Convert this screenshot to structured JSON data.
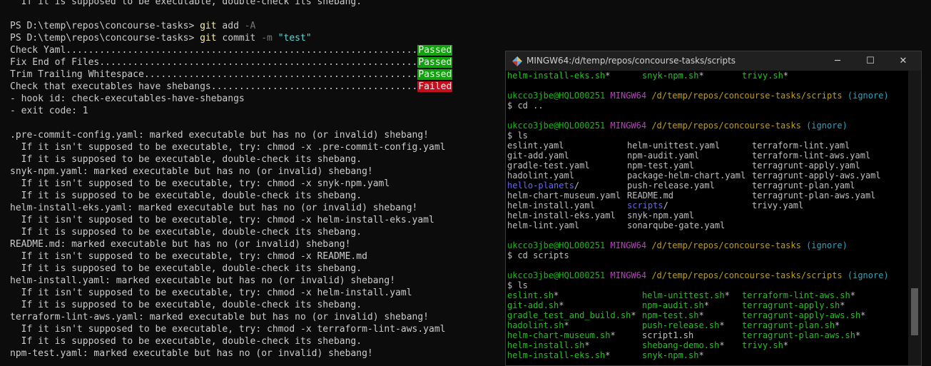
{
  "powershell": {
    "lines": [
      {
        "text": "  If it is supposed to be executable, double-check its shebang."
      },
      {
        "text": ""
      },
      {
        "prompt": "PS D:\\temp\\repos\\concourse-tasks> ",
        "cmd": "git",
        "args": " add ",
        "opt": "-A",
        "str": ""
      },
      {
        "prompt": "PS D:\\temp\\repos\\concourse-tasks> ",
        "cmd": "git",
        "args": " commit ",
        "opt": "-m",
        "str": " \"test\""
      },
      {
        "text": "Check Yaml...............................................................",
        "badge": "Passed",
        "status": "pass"
      },
      {
        "text": "Fix End of Files.........................................................",
        "badge": "Passed",
        "status": "pass"
      },
      {
        "text": "Trim Trailing Whitespace.................................................",
        "badge": "Passed",
        "status": "pass"
      },
      {
        "text": "Check that executables have shebangs.....................................",
        "badge": "Failed",
        "status": "fail"
      },
      {
        "text": "- hook id: check-executables-have-shebangs"
      },
      {
        "text": "- exit code: 1"
      },
      {
        "text": ""
      },
      {
        "text": ".pre-commit-config.yaml: marked executable but has no (or invalid) shebang!"
      },
      {
        "text": "  If it isn't supposed to be executable, try: chmod -x .pre-commit-config.yaml"
      },
      {
        "text": "  If it is supposed to be executable, double-check its shebang."
      },
      {
        "text": "snyk-npm.yaml: marked executable but has no (or invalid) shebang!"
      },
      {
        "text": "  If it isn't supposed to be executable, try: chmod -x snyk-npm.yaml"
      },
      {
        "text": "  If it is supposed to be executable, double-check its shebang."
      },
      {
        "text": "helm-install-eks.yaml: marked executable but has no (or invalid) shebang!"
      },
      {
        "text": "  If it isn't supposed to be executable, try: chmod -x helm-install-eks.yaml"
      },
      {
        "text": "  If it is supposed to be executable, double-check its shebang."
      },
      {
        "text": "README.md: marked executable but has no (or invalid) shebang!"
      },
      {
        "text": "  If it isn't supposed to be executable, try: chmod -x README.md"
      },
      {
        "text": "  If it is supposed to be executable, double-check its shebang."
      },
      {
        "text": "helm-install.yaml: marked executable but has no (or invalid) shebang!"
      },
      {
        "text": "  If it isn't supposed to be executable, try: chmod -x helm-install.yaml"
      },
      {
        "text": "  If it is supposed to be executable, double-check its shebang."
      },
      {
        "text": "terraform-lint-aws.yaml: marked executable but has no (or invalid) shebang!"
      },
      {
        "text": "  If it isn't supposed to be executable, try: chmod -x terraform-lint-aws.yaml"
      },
      {
        "text": "  If it is supposed to be executable, double-check its shebang."
      },
      {
        "text": "npm-test.yaml: marked executable but has no (or invalid) shebang!"
      }
    ]
  },
  "mingw": {
    "title": "MINGW64:/d/temp/repos/concourse-tasks/scripts",
    "buttons": {
      "minimize": "─",
      "maximize": "☐",
      "close": "✕"
    },
    "prompt_user": "ukcco3jbe@HQLO00251",
    "prompt_env": "MINGW64",
    "ignore": "(ignore)",
    "top_row": [
      "helm-install-eks.sh*",
      "snyk-npm.sh*",
      "trivy.sh*"
    ],
    "block1": {
      "path": "/d/temp/repos/concourse-tasks/scripts",
      "cmd": "$ cd .."
    },
    "block2": {
      "path": "/d/temp/repos/concourse-tasks",
      "cmd": "$ ls"
    },
    "ls1": [
      [
        {
          "t": "eslint.yaml",
          "c": ""
        },
        {
          "t": "helm-unittest.yaml",
          "c": ""
        },
        {
          "t": "terraform-lint.yaml",
          "c": ""
        }
      ],
      [
        {
          "t": "git-add.yaml",
          "c": ""
        },
        {
          "t": "npm-audit.yaml",
          "c": ""
        },
        {
          "t": "terraform-lint-aws.yaml",
          "c": ""
        }
      ],
      [
        {
          "t": "gradle-test.yaml",
          "c": ""
        },
        {
          "t": "npm-test.yaml",
          "c": ""
        },
        {
          "t": "terragrunt-apply.yaml",
          "c": ""
        }
      ],
      [
        {
          "t": "hadolint.yaml",
          "c": ""
        },
        {
          "t": "package-helm-chart.yaml",
          "c": ""
        },
        {
          "t": "terragrunt-apply-aws.yaml",
          "c": ""
        }
      ],
      [
        {
          "t": "hello-planets",
          "c": "dir",
          "s": "/"
        },
        {
          "t": "push-release.yaml",
          "c": ""
        },
        {
          "t": "terragrunt-plan.yaml",
          "c": ""
        }
      ],
      [
        {
          "t": "helm-chart-museum.yaml",
          "c": ""
        },
        {
          "t": "README.md",
          "c": ""
        },
        {
          "t": "terragrunt-plan-aws.yaml",
          "c": ""
        }
      ],
      [
        {
          "t": "helm-install.yaml",
          "c": ""
        },
        {
          "t": "scripts",
          "c": "dir",
          "s": "/"
        },
        {
          "t": "trivy.yaml",
          "c": ""
        }
      ],
      [
        {
          "t": "helm-install-eks.yaml",
          "c": ""
        },
        {
          "t": "snyk-npm.yaml",
          "c": ""
        },
        {
          "t": "",
          "c": ""
        }
      ],
      [
        {
          "t": "helm-lint.yaml",
          "c": ""
        },
        {
          "t": "sonarqube-gate.yaml",
          "c": ""
        },
        {
          "t": "",
          "c": ""
        }
      ]
    ],
    "block3": {
      "path": "/d/temp/repos/concourse-tasks",
      "cmd": "$ cd scripts"
    },
    "block4": {
      "path": "/d/temp/repos/concourse-tasks/scripts",
      "cmd": "$ ls"
    },
    "ls2": [
      [
        {
          "t": "eslint.sh",
          "c": "exe",
          "s": "*"
        },
        {
          "t": "helm-unittest.sh",
          "c": "exe",
          "s": "*"
        },
        {
          "t": "terraform-lint-aws.sh",
          "c": "exe",
          "s": "*"
        }
      ],
      [
        {
          "t": "git-add.sh",
          "c": "exe",
          "s": "*"
        },
        {
          "t": "npm-audit.sh",
          "c": "exe",
          "s": "*"
        },
        {
          "t": "terragrunt-apply.sh",
          "c": "exe",
          "s": "*"
        }
      ],
      [
        {
          "t": "gradle_test_and_build.sh",
          "c": "exe",
          "s": "*"
        },
        {
          "t": "npm-test.sh",
          "c": "exe",
          "s": "*"
        },
        {
          "t": "terragrunt-apply-aws.sh",
          "c": "exe",
          "s": "*"
        }
      ],
      [
        {
          "t": "hadolint.sh",
          "c": "exe",
          "s": "*"
        },
        {
          "t": "push-release.sh",
          "c": "exe",
          "s": "*"
        },
        {
          "t": "terragrunt-plan.sh",
          "c": "exe",
          "s": "*"
        }
      ],
      [
        {
          "t": "helm-chart-museum.sh",
          "c": "exe",
          "s": "*"
        },
        {
          "t": "script1.sh",
          "c": ""
        },
        {
          "t": "terragrunt-plan-aws.sh",
          "c": "exe",
          "s": "*"
        }
      ],
      [
        {
          "t": "helm-install.sh",
          "c": "exe",
          "s": "*"
        },
        {
          "t": "shebang-demo.sh",
          "c": "exe",
          "s": "*"
        },
        {
          "t": "trivy.sh",
          "c": "exe",
          "s": "*"
        }
      ],
      [
        {
          "t": "helm-install-eks.sh",
          "c": "exe",
          "s": "*"
        },
        {
          "t": "snyk-npm.sh",
          "c": "exe",
          "s": "*"
        },
        {
          "t": "",
          "c": ""
        }
      ]
    ]
  }
}
